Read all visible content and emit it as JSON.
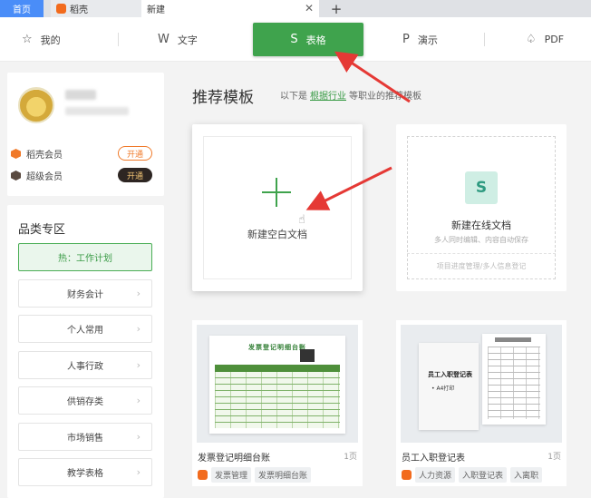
{
  "tabs": {
    "home": "首页",
    "daoke": "稻壳",
    "new": "新建",
    "close": "✕",
    "add": "+"
  },
  "nav": {
    "mine": "我的",
    "text": "文字",
    "sheet": "表格",
    "present": "演示",
    "pdf": "PDF",
    "icons": {
      "mine": "☆",
      "text": "W",
      "sheet": "S",
      "present": "P",
      "pdf": "♤"
    }
  },
  "user": {
    "members": [
      {
        "label": "稻壳会员",
        "btn": "开通"
      },
      {
        "label": "超级会员",
        "btn": "开通"
      }
    ]
  },
  "category": {
    "title": "品类专区",
    "hot": "热：工作计划",
    "items": [
      "财务会计",
      "个人常用",
      "人事行政",
      "供销存类",
      "市场销售",
      "教学表格"
    ]
  },
  "main": {
    "title": "推荐模板",
    "sub_prefix": "以下是",
    "sub_link": "根据行业",
    "sub_suffix": "等职业的推荐模板",
    "blank_label": "新建空白文档",
    "online_icon": "S",
    "online_title": "新建在线文档",
    "online_desc": "多人同时编辑、内容自动保存",
    "online_foot": "项目进度管理/多人信息登记",
    "templates": [
      {
        "name": "发票登记明细台账",
        "pages": "1页",
        "tags": [
          "发票管理",
          "发票明细台账"
        ],
        "thumb_title": "发票登记明细台账"
      },
      {
        "name": "员工入职登记表",
        "pages": "1页",
        "tags": [
          "人力资源",
          "入职登记表",
          "入离职"
        ],
        "thumb_title": "员工入职登记表",
        "thumb_bullet": "• A4打印"
      }
    ]
  },
  "colors": {
    "accent_green": "#3fa34d",
    "tab_blue": "#4a8df8",
    "arrow_red": "#e53935",
    "member_orange": "#f07a2a"
  }
}
